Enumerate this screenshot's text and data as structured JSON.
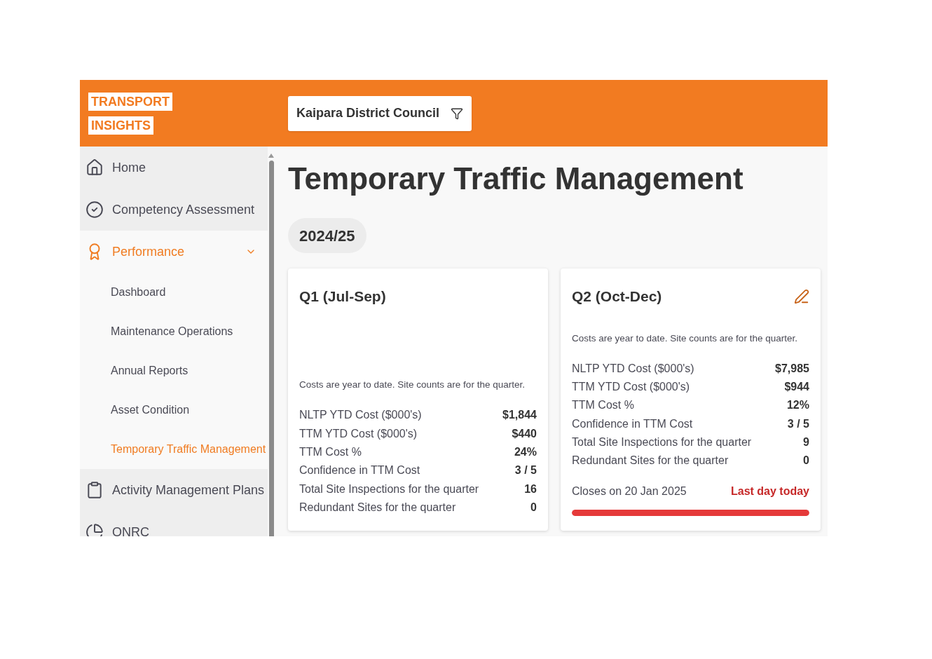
{
  "logo": {
    "lines": [
      "TRANSPORT",
      "INSIGHTS"
    ]
  },
  "filter": {
    "label": "Kaipara District Council"
  },
  "sidebar": {
    "items": [
      {
        "label": "Home",
        "kind": "home",
        "selected": false
      },
      {
        "label": "Competency Assessment",
        "kind": "assessment",
        "selected": false
      },
      {
        "label": "Performance",
        "kind": "performance",
        "selected": true,
        "expanded": true,
        "children": [
          {
            "label": "Dashboard",
            "selected": false
          },
          {
            "label": "Maintenance Operations",
            "selected": false
          },
          {
            "label": "Annual Reports",
            "selected": false
          },
          {
            "label": "Asset Condition",
            "selected": false
          },
          {
            "label": "Temporary Traffic Management",
            "selected": true
          }
        ]
      },
      {
        "label": "Activity Management Plans",
        "kind": "plans",
        "selected": false
      },
      {
        "label": "ONRC",
        "kind": "classification",
        "selected": false
      }
    ]
  },
  "page": {
    "title": "Temporary Traffic Management",
    "year": "2024/25"
  },
  "cards": [
    {
      "title": "Q1 (Jul-Sep)",
      "editable": false,
      "note": "Costs are year to date. Site counts are for the quarter.",
      "rows": [
        {
          "label": "NLTP YTD Cost ($000's)",
          "value": "$1,844"
        },
        {
          "label": "TTM YTD Cost ($000's)",
          "value": "$440"
        },
        {
          "label": "TTM Cost %",
          "value": "24%"
        },
        {
          "label": "Confidence in TTM Cost",
          "value": "3 / 5"
        },
        {
          "label": "Total Site Inspections for the quarter",
          "value": "16"
        },
        {
          "label": "Redundant Sites for the quarter",
          "value": "0"
        }
      ]
    },
    {
      "title": "Q2 (Oct-Dec)",
      "editable": true,
      "note": "Costs are year to date. Site counts are for the quarter.",
      "rows": [
        {
          "label": "NLTP YTD Cost ($000's)",
          "value": "$7,985"
        },
        {
          "label": "TTM YTD Cost ($000's)",
          "value": "$944"
        },
        {
          "label": "TTM Cost %",
          "value": "12%"
        },
        {
          "label": "Confidence in TTM Cost",
          "value": "3 / 5"
        },
        {
          "label": "Total Site Inspections for the quarter",
          "value": "9"
        },
        {
          "label": "Redundant Sites for the quarter",
          "value": "0"
        }
      ],
      "deadline": {
        "text": "Closes on 20 Jan 2025",
        "status": "Last day today",
        "level": 1
      }
    }
  ]
}
